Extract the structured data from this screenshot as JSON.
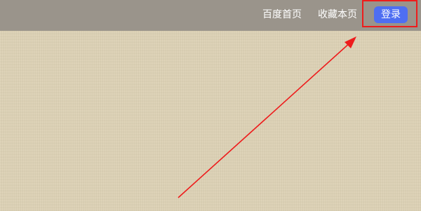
{
  "header": {
    "links": [
      {
        "label": "百度首页"
      },
      {
        "label": "收藏本页"
      }
    ],
    "login_label": "登录"
  },
  "colors": {
    "topbar": "#9a948b",
    "background": "#dcd1b4",
    "login_button": "#4e6ef2",
    "annotation": "#ee1c1c"
  }
}
